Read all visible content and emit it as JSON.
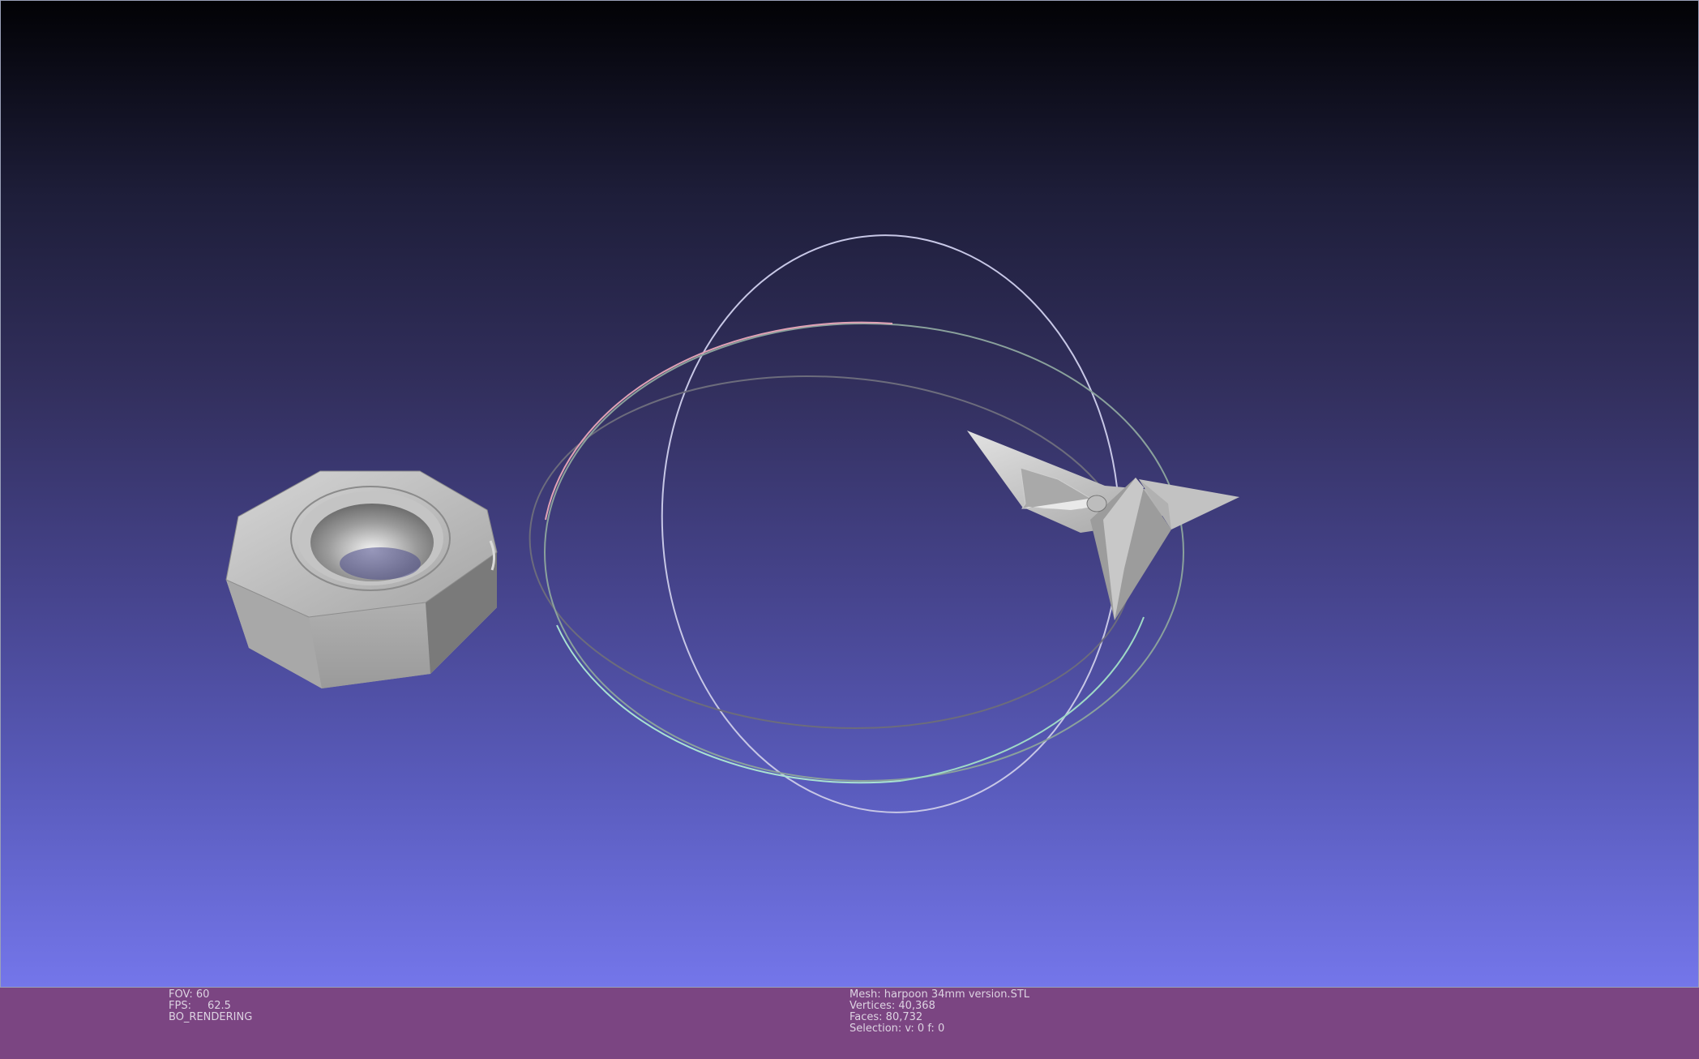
{
  "viewport": {
    "objects": [
      "hex-nut-mesh",
      "harpoon-mesh",
      "trackball-gizmo"
    ]
  },
  "info_left": {
    "fov_label": "FOV:",
    "fov_value": "60",
    "fps_label": "FPS:",
    "fps_value": "62.5",
    "render_mode": "BO_RENDERING"
  },
  "info_right": {
    "mesh": "Mesh: harpoon 34mm version.STL",
    "vertices": "Vertices: 40,368",
    "faces": "Faces: 80,732",
    "selection": "Selection: v: 0 f: 0"
  },
  "colors": {
    "background_top": "#020205",
    "background_bottom": "#7476ea",
    "infobar": "#7b4582",
    "mesh": "#b8b8b8"
  }
}
